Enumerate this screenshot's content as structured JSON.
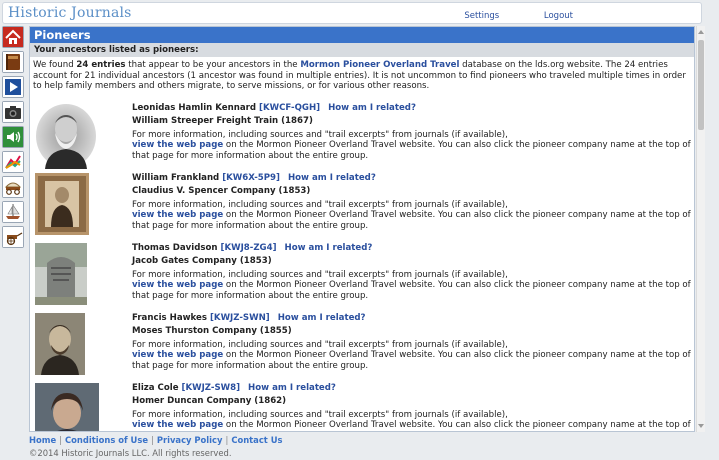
{
  "app": {
    "brand": "Historic Journals",
    "nav": {
      "settings": "Settings",
      "logout": "Logout"
    }
  },
  "page": {
    "title": "Pioneers",
    "subtitle": "Your ancestors listed as pioneers:",
    "intro": {
      "p1": "We found ",
      "count_entries": "24 entries",
      "p2": " that appear to be your ancestors in the ",
      "db_link": "Mormon Pioneer Overland Travel",
      "p3": " database on the lds.org website. The 24 entries account for 21 individual ancestors (1 ancestor was found in multiple entries). It is not uncommon to find pioneers who traveled multiple times in order to help family members and others migrate, to serve missions, or for various other reasons."
    }
  },
  "common": {
    "related_label": "How am I related?",
    "more_info_pre": "For more information, including sources and \"trail excerpts\" from journals (if available),",
    "web_link": "view the web page",
    "more_info_post": " on the Mormon Pioneer Overland Travel website. You can also click the pioneer company name at the top of that page for more information about the entire group."
  },
  "entries": [
    {
      "name": "Leonidas Hamlin Kennard",
      "id": "[KWCF-QGH]",
      "company": "William Streeper Freight Train (1867)"
    },
    {
      "name": "William Frankland",
      "id": "[KW6X-5P9]",
      "company": "Claudius V. Spencer Company (1853)"
    },
    {
      "name": "Thomas Davidson",
      "id": "[KWJ8-ZG4]",
      "company": "Jacob Gates Company (1853)"
    },
    {
      "name": "Francis Hawkes",
      "id": "[KWJZ-SWN]",
      "company": "Moses Thurston Company (1855)"
    },
    {
      "name": "Eliza Cole",
      "id": "[KWJZ-SW8]",
      "company": "Homer Duncan Company (1862)"
    }
  ],
  "icons": [
    "home-icon",
    "journal-book-icon",
    "play-video-icon",
    "camera-icon",
    "audio-speaker-icon",
    "chart-icon",
    "wagon-icon",
    "ship-icon",
    "handcart-icon"
  ],
  "footer": {
    "links": [
      "Home",
      "Conditions of Use",
      "Privacy Policy",
      "Contact Us"
    ],
    "copyright": "©2014 Historic Journals LLC.    All rights reserved."
  },
  "colors": {
    "accent": "#3a73c9",
    "link": "#2a4f9e",
    "brand": "#5b8fc7"
  }
}
